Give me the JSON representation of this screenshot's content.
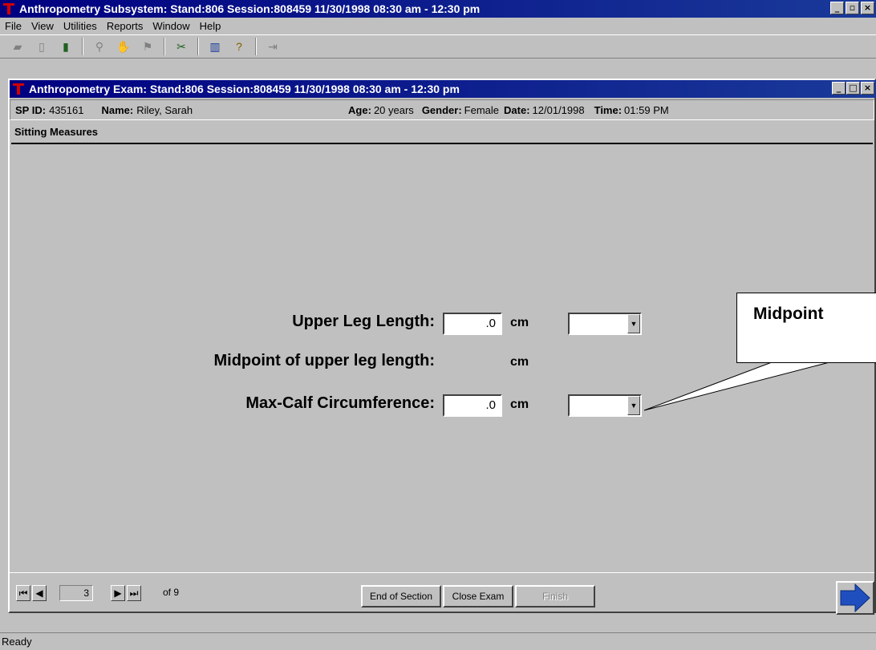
{
  "app": {
    "title": "Anthropometry Subsystem: Stand:806 Session:808459 11/30/1998 08:30 am - 12:30 pm"
  },
  "menu": [
    "File",
    "View",
    "Utilities",
    "Reports",
    "Window",
    "Help"
  ],
  "child_window": {
    "title": "Anthropometry Exam: Stand:806 Session:808459 11/30/1998 08:30 am - 12:30 pm"
  },
  "participant": {
    "spid_label": "SP ID:",
    "spid": "435161",
    "name_label": "Name:",
    "name": "Riley, Sarah",
    "age_label": "Age:",
    "age": "20 years",
    "gender_label": "Gender:",
    "gender": "Female",
    "date_label": "Date:",
    "date": "12/01/1998",
    "time_label": "Time:",
    "time": "01:59 PM"
  },
  "section": {
    "title": "Sitting Measures"
  },
  "fields": {
    "upper_leg": {
      "label": "Upper Leg Length:",
      "value": ".0",
      "unit": "cm"
    },
    "midpoint": {
      "label": "Midpoint of upper leg length:",
      "unit": "cm"
    },
    "calf": {
      "label": "Max-Calf Circumference:",
      "value": ".0",
      "unit": "cm"
    }
  },
  "callout": {
    "text": "Midpoint"
  },
  "navigation": {
    "page": "3",
    "of_text": "of 9",
    "end_section": "End of Section",
    "close_exam": "Close Exam",
    "finish": "Finish"
  },
  "status": {
    "text": "Ready"
  }
}
